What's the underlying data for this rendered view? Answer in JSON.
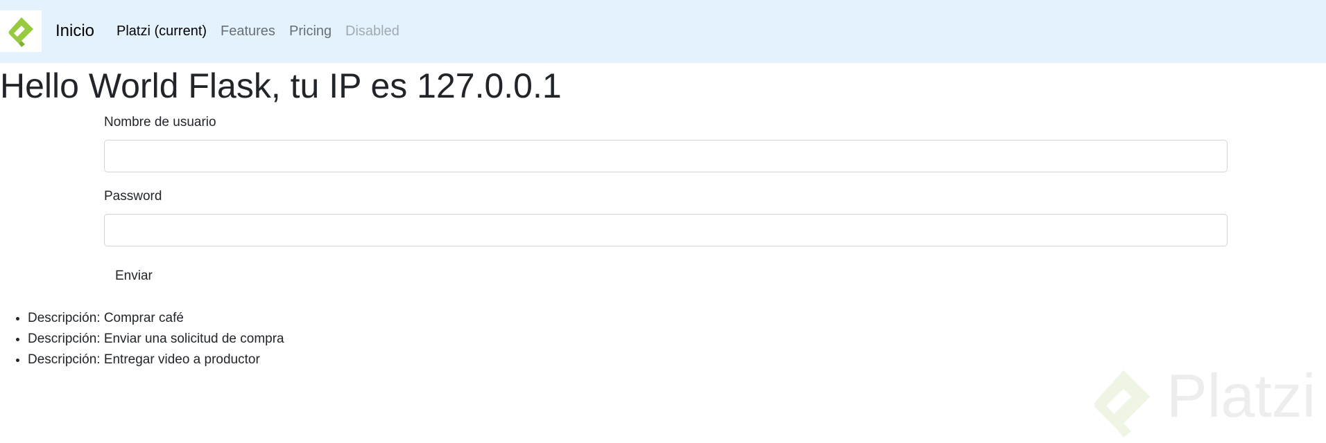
{
  "navbar": {
    "brand": "Inicio",
    "logo_icon": "platzi-logo-icon",
    "links": [
      {
        "label": "Platzi (current)",
        "state": "active"
      },
      {
        "label": "Features",
        "state": "normal"
      },
      {
        "label": "Pricing",
        "state": "normal"
      },
      {
        "label": "Disabled",
        "state": "disabled"
      }
    ]
  },
  "main": {
    "title": "Hello World Flask, tu IP es 127.0.0.1",
    "form": {
      "username_label": "Nombre de usuario",
      "username_value": "",
      "password_label": "Password",
      "password_value": "",
      "submit_label": "Enviar"
    },
    "todos": [
      "Descripción: Comprar café",
      "Descripción: Enviar una solicitud de compra",
      "Descripción: Entregar video a productor"
    ]
  },
  "watermark": {
    "text": "Platzi"
  },
  "colors": {
    "navbar_bg": "#e3f2fd",
    "brand_green": "#98ca3f",
    "text": "#212529"
  }
}
